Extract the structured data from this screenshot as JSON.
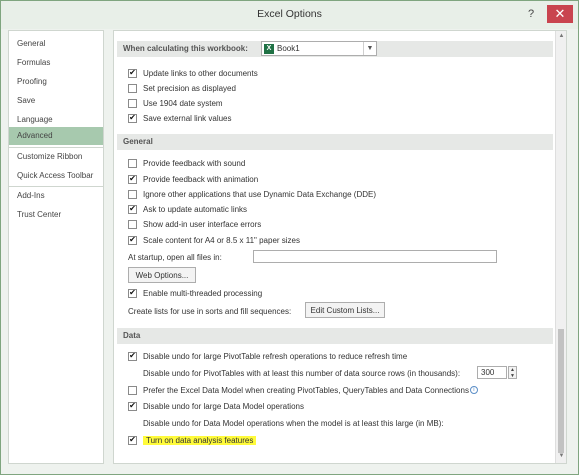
{
  "window": {
    "title": "Excel Options",
    "help_glyph": "?",
    "close_glyph": "✕"
  },
  "sidebar": {
    "items": [
      {
        "label": "General"
      },
      {
        "label": "Formulas"
      },
      {
        "label": "Proofing"
      },
      {
        "label": "Save"
      },
      {
        "label": "Language"
      },
      {
        "label": "Advanced"
      },
      {
        "label": "Customize Ribbon"
      },
      {
        "label": "Quick Access Toolbar"
      },
      {
        "label": "Add-Ins"
      },
      {
        "label": "Trust Center"
      }
    ],
    "selected": "Advanced"
  },
  "workbook_section": {
    "label": "When calculating this workbook:",
    "workbook_value": "Book1",
    "workbook_icon": "X",
    "options": [
      {
        "label": "Update links to other documents",
        "checked": true
      },
      {
        "label": "Set precision as displayed",
        "checked": false
      },
      {
        "label": "Use 1904 date system",
        "checked": false
      },
      {
        "label": "Save external link values",
        "checked": true
      }
    ]
  },
  "general_section": {
    "header": "General",
    "options": [
      {
        "label": "Provide feedback with sound",
        "checked": false
      },
      {
        "label": "Provide feedback with animation",
        "checked": true
      },
      {
        "label": "Ignore other applications that use Dynamic Data Exchange (DDE)",
        "checked": false
      },
      {
        "label": "Ask to update automatic links",
        "checked": true
      },
      {
        "label": "Show add-in user interface errors",
        "checked": false
      },
      {
        "label": "Scale content for A4 or 8.5 x 11\" paper sizes",
        "checked": true
      }
    ],
    "startup_label": "At startup, open all files in:",
    "startup_value": "",
    "web_options_button": "Web Options...",
    "multithread_option": {
      "label": "Enable multi-threaded processing",
      "checked": true
    },
    "create_lists_label": "Create lists for use in sorts and fill sequences:",
    "edit_lists_button": "Edit Custom Lists..."
  },
  "data_section": {
    "header": "Data",
    "options": [
      {
        "label": "Disable undo for large PivotTable refresh operations to reduce refresh time",
        "checked": true
      },
      {
        "label": "Prefer the Excel Data Model when creating PivotTables, QueryTables and Data Connections",
        "checked": false
      },
      {
        "label": "Disable undo for large Data Model operations",
        "checked": true
      },
      {
        "label": "Turn on data analysis features",
        "checked": true
      }
    ],
    "pivot_rows_label": "Disable undo for PivotTables with at least this number of data source rows (in thousands):",
    "pivot_rows_value": "300",
    "data_model_label": "Disable undo for Data Model operations when the model is at least this large (in MB):",
    "info_glyph": "i"
  },
  "colors": {
    "selected_nav": "#a7c9ae",
    "close_button": "#c9444f",
    "highlight": "#fffb3a",
    "excel_green": "#207245"
  }
}
